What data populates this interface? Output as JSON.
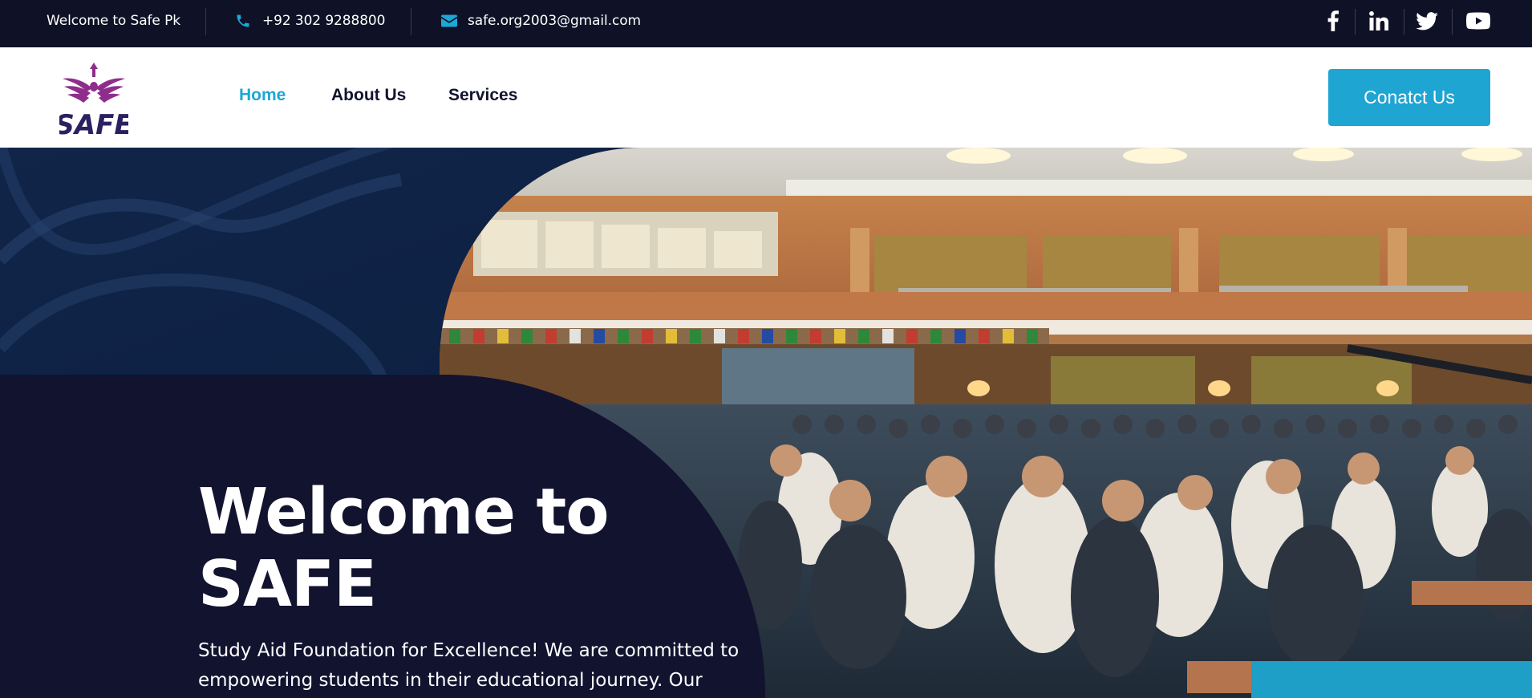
{
  "topbar": {
    "welcome": "Welcome to Safe Pk",
    "phone": "+92 302 9288800",
    "email": "safe.org2003@gmail.com",
    "phone_icon": "phone-icon",
    "email_icon": "envelope-icon",
    "social": [
      "facebook-icon",
      "linkedin-icon",
      "twitter-icon",
      "youtube-icon"
    ]
  },
  "nav": {
    "logo_text": "SAFE",
    "links": [
      "Home",
      "About Us",
      "Services"
    ],
    "active": "Home",
    "cta": "Conatct Us"
  },
  "hero": {
    "title_line1": "Welcome to",
    "title_line2": "SAFE",
    "text": "Study Aid Foundation for Excellence! We are committed to empowering students in their educational journey. Our"
  },
  "colors": {
    "topbar_bg": "#0f1227",
    "accent": "#1ea7d6",
    "navy": "#12132f",
    "logo_purple": "#8e2d8b",
    "logo_navy": "#2b2160"
  }
}
